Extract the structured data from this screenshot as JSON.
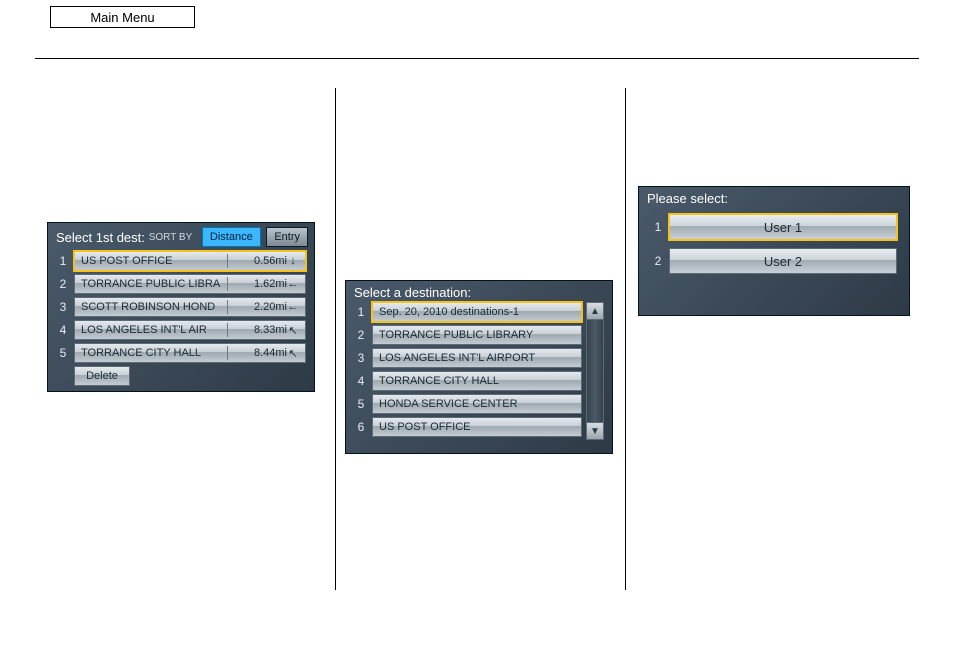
{
  "top": {
    "main_menu": "Main Menu"
  },
  "screen1": {
    "title": "Select 1st dest:",
    "sort_by_label": "SORT BY",
    "sort_distance": "Distance",
    "sort_entry": "Entry",
    "rows": [
      {
        "n": "1",
        "name": "US POST OFFICE",
        "dist": "0.56mi",
        "dir": "↓"
      },
      {
        "n": "2",
        "name": "TORRANCE PUBLIC LIBRA",
        "dist": "1.62mi",
        "dir": "←"
      },
      {
        "n": "3",
        "name": "SCOTT ROBINSON HOND",
        "dist": "2.20mi",
        "dir": "←"
      },
      {
        "n": "4",
        "name": "LOS ANGELES INT'L AIR",
        "dist": "8.33mi",
        "dir": "↖"
      },
      {
        "n": "5",
        "name": "TORRANCE CITY HALL",
        "dist": "8.44mi",
        "dir": "↖"
      }
    ],
    "delete": "Delete"
  },
  "screen2": {
    "title": "Select a destination:",
    "rows": [
      {
        "n": "1",
        "name": "Sep. 20, 2010 destinations-1"
      },
      {
        "n": "2",
        "name": "TORRANCE PUBLIC LIBRARY"
      },
      {
        "n": "3",
        "name": "LOS ANGELES INT'L AIRPORT"
      },
      {
        "n": "4",
        "name": "TORRANCE CITY HALL"
      },
      {
        "n": "5",
        "name": "HONDA SERVICE CENTER"
      },
      {
        "n": "6",
        "name": "US POST OFFICE"
      }
    ],
    "scroll_up": "▲",
    "scroll_down": "▼"
  },
  "screen3": {
    "title": "Please select:",
    "rows": [
      {
        "n": "1",
        "name": "User 1"
      },
      {
        "n": "2",
        "name": "User 2"
      }
    ]
  }
}
